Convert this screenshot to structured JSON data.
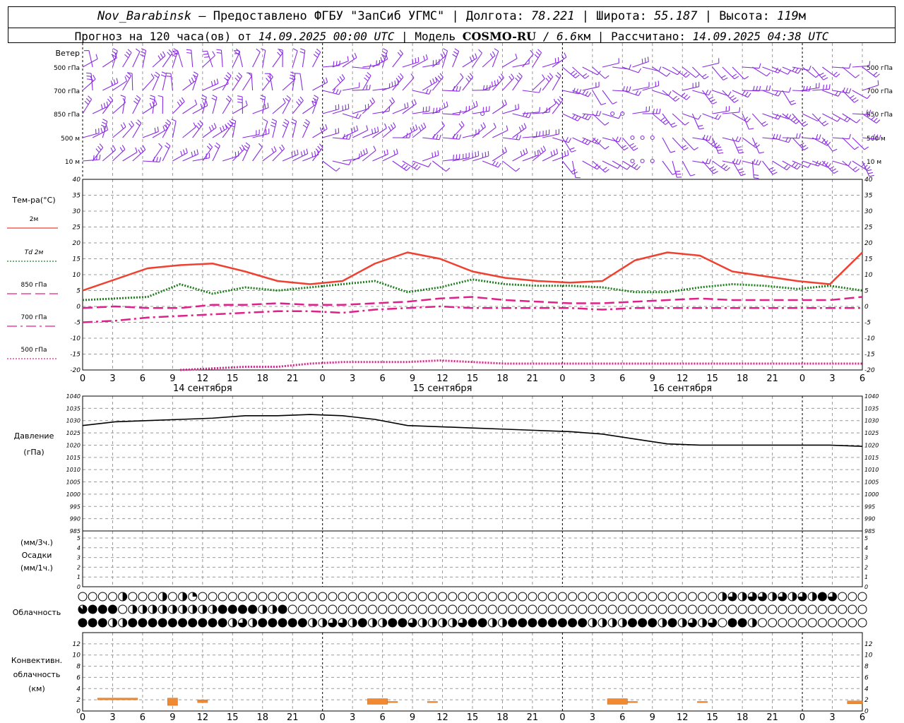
{
  "header": {
    "station": "Nov_Barabinsk",
    "provider_text": " — Предоставлено ФГБУ \"ЗапСиб УГМС\" | Долгота: ",
    "lon": "78.221",
    "lat_label": " | Широта: ",
    "lat": "55.187",
    "alt_label": " | Высота: ",
    "alt": "119",
    "alt_unit": "м",
    "forecast_label": "Прогноз на 120 часа(ов) от ",
    "forecast_start": "14.09.2025 00:00 UTC",
    "model_label": " | Модель ",
    "model": "COSMO-RU",
    "model_res": " / 6.6",
    "model_res_unit": "км",
    "calc_label": " | Рассчитано: ",
    "calc_time": "14.09.2025 04:38 UTC"
  },
  "colors": {
    "wind": "#8a2be2",
    "t2m": "#ef4030",
    "td2m": "#1f7f1f",
    "t850": "#e0208a",
    "pressure": "#000000",
    "convective": "#ef8a33",
    "grid": "#999999"
  },
  "chart_data": [
    {
      "type": "wind_barbs",
      "title": "Ветер",
      "levels": [
        "500 гПа",
        "700 гПа",
        "850 гПа",
        "500 м",
        "10  м"
      ],
      "calm_marker": "circle"
    },
    {
      "type": "line",
      "ylabel": "Тем-ра(°С)",
      "ylim": [
        -20,
        40
      ],
      "yticks": [
        -20,
        -15,
        -10,
        -5,
        0,
        5,
        10,
        15,
        20,
        25,
        30,
        35,
        40
      ],
      "x_hours": [
        0,
        3,
        6,
        9,
        12,
        15,
        18,
        21,
        24,
        27,
        30,
        33,
        36,
        39,
        42,
        45,
        48,
        51,
        54,
        57,
        60,
        63,
        66,
        69,
        72,
        75,
        78
      ],
      "xtick_labels": [
        "0",
        "3",
        "6",
        "9",
        "12",
        "15",
        "18",
        "21",
        "0",
        "3",
        "6",
        "9",
        "12",
        "15",
        "18",
        "21",
        "0",
        "3",
        "6",
        "9",
        "12",
        "15",
        "18",
        "21",
        "0",
        "3",
        "6"
      ],
      "day_labels": [
        {
          "hour": 12,
          "text": "14 сентября"
        },
        {
          "hour": 36,
          "text": "15 сентября"
        },
        {
          "hour": 60,
          "text": "16 сентября"
        }
      ],
      "series": [
        {
          "name": "2м",
          "color_key": "t2m",
          "style": "solid",
          "width": 2.5,
          "values": [
            5,
            8.5,
            12,
            13,
            13.5,
            11,
            8,
            7,
            8,
            13.5,
            17,
            15,
            11,
            9,
            8,
            7.5,
            8,
            14.5,
            17,
            16,
            11,
            9.5,
            8,
            7,
            17
          ]
        },
        {
          "name": "Td  2м",
          "color_key": "td2m",
          "style": "dotted",
          "width": 3,
          "values": [
            2,
            2.5,
            3,
            7,
            4,
            6,
            5,
            6,
            7,
            8,
            4.5,
            6,
            8.5,
            7,
            6.5,
            6.5,
            6,
            4.5,
            4.5,
            6,
            7,
            6.5,
            5.5,
            6.5,
            5
          ]
        },
        {
          "name": "850 гПа",
          "color_key": "t850",
          "style": "longdash",
          "width": 2.5,
          "values": [
            -0.5,
            0,
            -0.5,
            -0.5,
            0.5,
            0.5,
            1,
            0.5,
            0.5,
            1,
            1.5,
            2.5,
            3,
            2,
            1.5,
            1,
            1,
            1.5,
            2,
            2.5,
            2,
            2,
            2,
            2,
            3
          ]
        },
        {
          "name": "700 гПа",
          "color_key": "t850",
          "style": "dashdot",
          "width": 2.5,
          "values": [
            -5,
            -4.5,
            -3.5,
            -3,
            -2.5,
            -2,
            -1.5,
            -1.5,
            -2,
            -1,
            -0.5,
            0,
            -0.5,
            -0.5,
            -0.5,
            -0.5,
            -1,
            -0.5,
            -0.5,
            -0.5,
            -0.5,
            -0.5,
            -0.5,
            -0.5,
            -0.5
          ]
        },
        {
          "name": "500 гПа",
          "color_key": "t850",
          "style": "dotted",
          "width": 3,
          "start_index": 3,
          "values": [
            -20,
            -19.5,
            -19,
            -19,
            -18,
            -17.5,
            -17.5,
            -17.5,
            -17,
            -17.5,
            -18,
            -18,
            -18,
            -18,
            -18,
            -18,
            -18,
            -18,
            -18,
            -18,
            -18,
            -18
          ]
        }
      ]
    },
    {
      "type": "line",
      "ylabel": "Давление",
      "ylabel2": "(гПа)",
      "ylim": [
        985,
        1040
      ],
      "yticks": [
        985,
        990,
        995,
        1000,
        1005,
        1010,
        1015,
        1020,
        1025,
        1030,
        1035,
        1040
      ],
      "series": [
        {
          "name": "Давление",
          "color_key": "pressure",
          "values": [
            1028,
            1029.5,
            1030,
            1030.5,
            1031,
            1032,
            1032,
            1032.5,
            1032,
            1030.5,
            1028,
            1027.5,
            1027,
            1026.5,
            1026,
            1025.5,
            1024.5,
            1022.5,
            1020.5,
            1020,
            1020,
            1020,
            1020,
            1020,
            1019.5
          ]
        }
      ]
    },
    {
      "type": "bar",
      "ylabel": "(мм/3ч.)",
      "ylabel2": "Осадки",
      "ylabel3": "(мм/1ч.)",
      "ylim": [
        0,
        5
      ],
      "yticks": [
        0,
        1,
        2,
        3,
        4,
        5
      ],
      "values": []
    },
    {
      "type": "cloud_symbols",
      "ylabel": "Облачность",
      "rows": 3,
      "columns": 79,
      "fill_codes_0_to_8": [
        "000040004042000000000000000000000000000000000000000000000000000046466464648600",
        "788804444444448888448000000000000000000000000000000000000000000000000000000000",
        "888448888888888464888884466484488644446884488888888444488848464608840000000000"
      ]
    },
    {
      "type": "bar",
      "ylabel": "Конвективн.",
      "ylabel2": "облачность",
      "ylabel3": "(км)",
      "ylim": [
        0,
        14
      ],
      "yticks": [
        0,
        2,
        4,
        6,
        8,
        10,
        12
      ],
      "bars": [
        {
          "from": 1.5,
          "to": 5.5,
          "base": 2.0,
          "top": 2.3
        },
        {
          "from": 8.5,
          "to": 9.5,
          "base": 1.0,
          "top": 2.3
        },
        {
          "from": 11.5,
          "to": 12.5,
          "base": 1.5,
          "top": 2.0
        },
        {
          "from": 28.5,
          "to": 30.5,
          "base": 1.2,
          "top": 2.2
        },
        {
          "from": 30.5,
          "to": 31.5,
          "base": 1.5,
          "top": 1.7
        },
        {
          "from": 34.5,
          "to": 35.5,
          "base": 1.5,
          "top": 1.7
        },
        {
          "from": 52.5,
          "to": 54.5,
          "base": 1.2,
          "top": 2.2
        },
        {
          "from": 54.5,
          "to": 55.5,
          "base": 1.5,
          "top": 1.7
        },
        {
          "from": 61.5,
          "to": 62.5,
          "base": 1.5,
          "top": 1.7
        },
        {
          "from": 76.5,
          "to": 78,
          "base": 1.3,
          "top": 1.8
        }
      ]
    }
  ]
}
